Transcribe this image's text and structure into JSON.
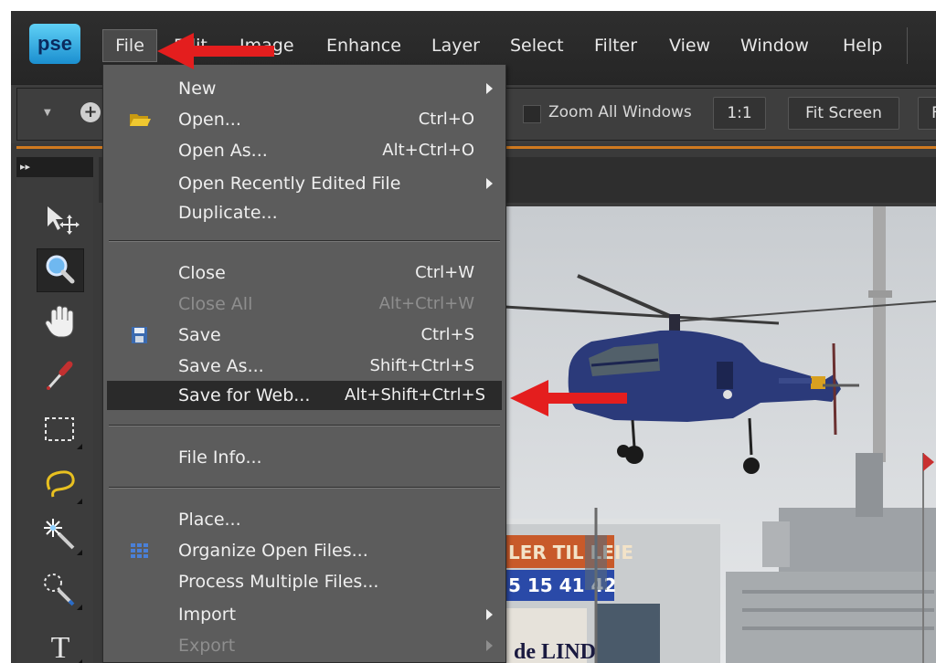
{
  "app": {
    "logo": "pse"
  },
  "menubar": {
    "items": [
      "File",
      "Edit",
      "Image",
      "Enhance",
      "Layer",
      "Select",
      "Filter",
      "View",
      "Window",
      "Help"
    ]
  },
  "options": {
    "zoom_all_windows": "Zoom All Windows",
    "one_to_one": "1:1",
    "fit_screen": "Fit Screen",
    "next_partial": "F"
  },
  "file_menu": {
    "items": [
      {
        "label": "New",
        "shortcut": "",
        "submenu": true,
        "enabled": true,
        "icon": ""
      },
      {
        "label": "Open...",
        "shortcut": "Ctrl+O",
        "submenu": false,
        "enabled": true,
        "icon": "folder-icon"
      },
      {
        "label": "Open As...",
        "shortcut": "Alt+Ctrl+O",
        "submenu": false,
        "enabled": true,
        "icon": ""
      },
      {
        "label": "Open Recently Edited File",
        "shortcut": "",
        "submenu": true,
        "enabled": true,
        "icon": ""
      },
      {
        "label": "Duplicate...",
        "shortcut": "",
        "submenu": false,
        "enabled": true,
        "icon": ""
      },
      {
        "label": "Close",
        "shortcut": "Ctrl+W",
        "submenu": false,
        "enabled": true,
        "icon": ""
      },
      {
        "label": "Close All",
        "shortcut": "Alt+Ctrl+W",
        "submenu": false,
        "enabled": false,
        "icon": ""
      },
      {
        "label": "Save",
        "shortcut": "Ctrl+S",
        "submenu": false,
        "enabled": true,
        "icon": "floppy-disk-icon"
      },
      {
        "label": "Save As...",
        "shortcut": "Shift+Ctrl+S",
        "submenu": false,
        "enabled": true,
        "icon": ""
      },
      {
        "label": "Save for Web...",
        "shortcut": "Alt+Shift+Ctrl+S",
        "submenu": false,
        "enabled": true,
        "icon": "",
        "highlighted": true
      },
      {
        "label": "File Info...",
        "shortcut": "",
        "submenu": false,
        "enabled": true,
        "icon": ""
      },
      {
        "label": "Place...",
        "shortcut": "",
        "submenu": false,
        "enabled": true,
        "icon": ""
      },
      {
        "label": "Organize Open Files...",
        "shortcut": "",
        "submenu": false,
        "enabled": true,
        "icon": "grid-icon"
      },
      {
        "label": "Process Multiple Files...",
        "shortcut": "",
        "submenu": false,
        "enabled": true,
        "icon": ""
      },
      {
        "label": "Import",
        "shortcut": "",
        "submenu": true,
        "enabled": true,
        "icon": ""
      },
      {
        "label": "Export",
        "shortcut": "",
        "submenu": true,
        "enabled": false,
        "icon": ""
      }
    ]
  },
  "tools": [
    "move-tool-icon",
    "zoom-tool-icon",
    "hand-tool-icon",
    "eyedropper-tool-icon",
    "rectangular-marquee-icon",
    "lasso-tool-icon",
    "magic-wand-icon",
    "quick-selection-icon",
    "type-tool-icon"
  ],
  "photo": {
    "sign_line1": "LER TIL LEIE",
    "sign_line2": "5 15 41 42",
    "sign_lower": "de LIND"
  },
  "colors": {
    "annotation_arrow": "#e41e1e",
    "accent_line": "#d07a20",
    "highlight": "#2a2a2a"
  }
}
